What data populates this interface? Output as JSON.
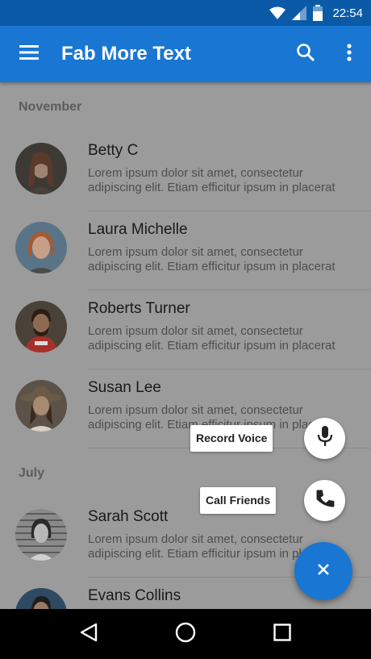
{
  "status_bar": {
    "time": "22:54"
  },
  "app_bar": {
    "title": "Fab More Text"
  },
  "sections": [
    {
      "header": "November",
      "items": [
        {
          "name": "Betty C",
          "text": "Lorem ipsum dolor sit amet, consectetur adipiscing elit. Etiam efficitur ipsum in placerat"
        },
        {
          "name": "Laura Michelle",
          "text": "Lorem ipsum dolor sit amet, consectetur adipiscing elit. Etiam efficitur ipsum in placerat"
        },
        {
          "name": "Roberts Turner",
          "text": "Lorem ipsum dolor sit amet, consectetur adipiscing elit. Etiam efficitur ipsum in placerat"
        },
        {
          "name": "Susan Lee",
          "text": "Lorem ipsum dolor sit amet, consectetur adipiscing elit. Etiam efficitur ipsum in placerat"
        }
      ]
    },
    {
      "header": "July",
      "items": [
        {
          "name": "Sarah Scott",
          "text": "Lorem ipsum dolor sit amet, consectetur adipiscing elit. Etiam efficitur ipsum in placerat"
        },
        {
          "name": "Evans Collins",
          "text": ""
        }
      ]
    }
  ],
  "fab_menu": {
    "record_voice_label": "Record Voice",
    "call_friends_label": "Call Friends"
  },
  "colors": {
    "primary": "#1976d2",
    "primary_dark": "#0a5aa8",
    "scrim_bg": "#9b9b9b"
  }
}
